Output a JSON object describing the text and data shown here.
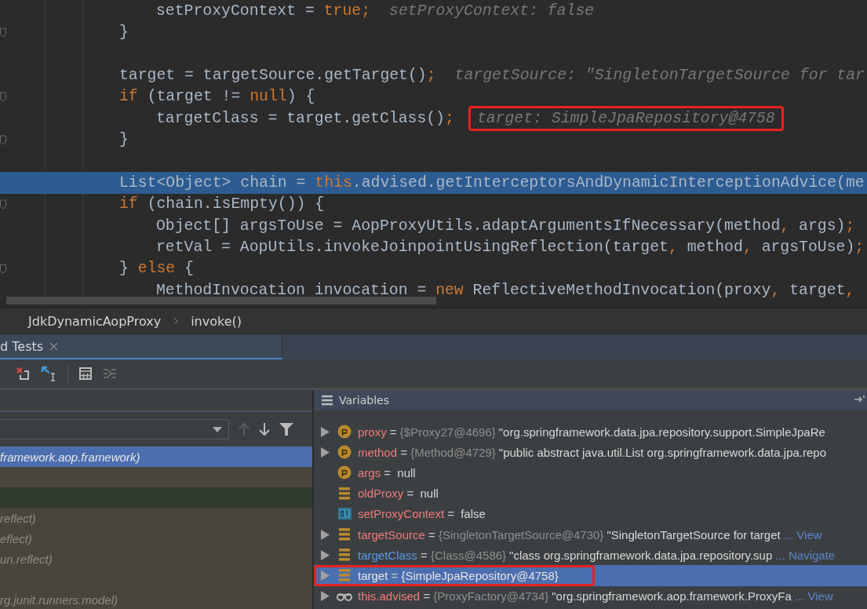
{
  "editor": {
    "lines": [
      {
        "kind": "inner",
        "fold": false,
        "highlighted": false,
        "segments": [
          {
            "kind": "code",
            "text": "setProxyContext = "
          },
          {
            "kind": "keyword",
            "text": "true;"
          },
          {
            "kind": "hint",
            "text": "setProxyContext: false"
          }
        ]
      },
      {
        "kind": "outer",
        "fold": true,
        "highlighted": false,
        "segments": [
          {
            "kind": "code",
            "text": "}"
          }
        ]
      },
      {
        "kind": "outer",
        "fold": false,
        "highlighted": false
      },
      {
        "kind": "outer",
        "fold": false,
        "highlighted": false,
        "segments": [
          {
            "kind": "code",
            "text": "target = targetSource.getTarget()"
          },
          {
            "kind": "keyword",
            "text": ";"
          },
          {
            "kind": "hint",
            "text": "targetSource: \"SingletonTargetSource for tar"
          }
        ]
      },
      {
        "kind": "outer",
        "fold": true,
        "highlighted": false,
        "segments": [
          {
            "kind": "keyword",
            "text": "if "
          },
          {
            "kind": "code",
            "text": "(target != "
          },
          {
            "kind": "keyword",
            "text": "null"
          },
          {
            "kind": "code",
            "text": ") {"
          }
        ]
      },
      {
        "kind": "inner",
        "fold": false,
        "highlighted": false,
        "segments": [
          {
            "kind": "code",
            "text": "targetClass = target.getClass()"
          },
          {
            "kind": "keyword",
            "text": ";"
          },
          {
            "kind": "hint",
            "text": "target: SimpleJpaRepository@4758",
            "annotated": true
          }
        ]
      },
      {
        "kind": "outer",
        "fold": true,
        "highlighted": false,
        "segments": [
          {
            "kind": "code",
            "text": "}"
          }
        ]
      },
      {
        "kind": "outer",
        "fold": false,
        "highlighted": false
      },
      {
        "kind": "outer",
        "fold": false,
        "highlighted": true,
        "segments": [
          {
            "kind": "code",
            "text": "List<Object> chain = "
          },
          {
            "kind": "keyword",
            "text": "this"
          },
          {
            "kind": "code",
            "text": ".advised.getInterceptorsAndDynamicInterceptionAdvice(me"
          }
        ]
      },
      {
        "kind": "outer",
        "fold": true,
        "highlighted": false,
        "segments": [
          {
            "kind": "keyword",
            "text": "if "
          },
          {
            "kind": "code",
            "text": "(chain.isEmpty()) {"
          }
        ]
      },
      {
        "kind": "inner",
        "fold": false,
        "highlighted": false,
        "segments": [
          {
            "kind": "code",
            "text": "Object[] argsToUse = AopProxyUtils.adaptArgumentsIfNecessary(method"
          },
          {
            "kind": "keyword",
            "text": ", "
          },
          {
            "kind": "code",
            "text": "args)"
          },
          {
            "kind": "keyword",
            "text": ";"
          }
        ]
      },
      {
        "kind": "inner",
        "fold": false,
        "highlighted": false,
        "segments": [
          {
            "kind": "code",
            "text": "retVal = AopUtils.invokeJoinpointUsingReflection(target"
          },
          {
            "kind": "keyword",
            "text": ", "
          },
          {
            "kind": "code",
            "text": "method"
          },
          {
            "kind": "keyword",
            "text": ", "
          },
          {
            "kind": "code",
            "text": "argsToUse)"
          },
          {
            "kind": "keyword",
            "text": ";"
          }
        ]
      },
      {
        "kind": "outer",
        "fold": true,
        "highlighted": false,
        "segments": [
          {
            "kind": "code",
            "text": "} "
          },
          {
            "kind": "keyword",
            "text": "else "
          },
          {
            "kind": "code",
            "text": "{"
          }
        ]
      },
      {
        "kind": "inner",
        "fold": false,
        "highlighted": false,
        "segments": [
          {
            "kind": "code",
            "text": "MethodInvocation invocation = "
          },
          {
            "kind": "keyword",
            "text": "new "
          },
          {
            "kind": "code",
            "text": "ReflectiveMethodInvocation(proxy"
          },
          {
            "kind": "keyword",
            "text": ", "
          },
          {
            "kind": "code",
            "text": "target"
          },
          {
            "kind": "keyword",
            "text": ", "
          }
        ]
      }
    ]
  },
  "breadcrumb": [
    "JdkDynamicAopProxy",
    "invoke()"
  ],
  "debug_tab": {
    "label": "d Tests",
    "selected": true
  },
  "frames": {
    "rows": [
      {
        "text": "framework.aop.framework)",
        "selected": true
      },
      {
        "kind": "app",
        "selected": false
      },
      {
        "kind": "current",
        "selected": false
      },
      {
        "text": "reflect)",
        "kind": "library",
        "selected": false
      },
      {
        "text": "eflect)",
        "kind": "library",
        "selected": false
      },
      {
        "text": "un.reflect)",
        "kind": "library",
        "selected": false
      },
      {
        "kind": "library",
        "selected": false
      },
      {
        "text": "rg.junit.runners.model)",
        "kind": "library",
        "selected": false
      }
    ]
  },
  "variables": {
    "title": "Variables",
    "items": [
      {
        "kind": "param",
        "expandable": true,
        "selected": false,
        "name": "proxy",
        "color": "#f07b7b",
        "operator": "=",
        "type": "{$Proxy27@4696}",
        "value": "\"org.springframework.data.jpa.repository.support.SimpleJpaRe"
      },
      {
        "kind": "param",
        "expandable": true,
        "selected": false,
        "name": "method",
        "color": "#f07b7b",
        "operator": "=",
        "type": "{Method@4729}",
        "value": "\"public abstract java.util.List org.springframework.data.jpa.repo"
      },
      {
        "kind": "param",
        "expandable": false,
        "selected": false,
        "name": "args",
        "color": "#f07b7b",
        "operator": "=",
        "value": "null"
      },
      {
        "kind": "field",
        "expandable": false,
        "selected": false,
        "name": "oldProxy",
        "color": "#f07b7b",
        "operator": "=",
        "value": "null"
      },
      {
        "kind": "boolean",
        "expandable": false,
        "selected": false,
        "name": "setProxyContext",
        "color": "#f07b7b",
        "operator": "=",
        "value": "false"
      },
      {
        "kind": "field",
        "expandable": true,
        "selected": false,
        "name": "targetSource",
        "color": "#f07b7b",
        "operator": "=",
        "type": "{SingletonTargetSource@4730}",
        "value": "\"SingletonTargetSource for target",
        "link": "... View"
      },
      {
        "kind": "field",
        "expandable": true,
        "selected": false,
        "name": "targetClass",
        "color": "#5a9ce8",
        "operator": "=",
        "type": "{Class@4586}",
        "value": "\"class org.springframework.data.jpa.repository.sup",
        "link": "... Navigate"
      },
      {
        "kind": "field",
        "expandable": true,
        "selected": true,
        "annotated": true,
        "name": "target",
        "color": "#e6e6e6",
        "operator": "=",
        "type": "{SimpleJpaRepository@4758}"
      },
      {
        "kind": "watch",
        "expandable": true,
        "selected": false,
        "name": "this.advised",
        "color": "#f07b7b",
        "operator": "=",
        "type": "{ProxyFactory@4734}",
        "value": "\"org.springframework.aop.framework.ProxyFa",
        "link": "... View"
      }
    ]
  }
}
